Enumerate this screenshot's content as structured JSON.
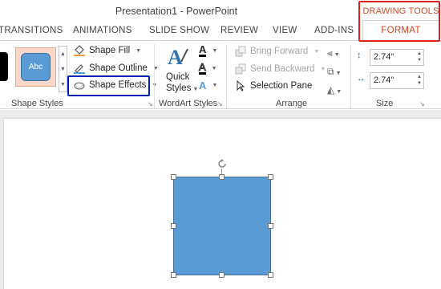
{
  "window": {
    "title": "Presentation1 - PowerPoint"
  },
  "context_tab": {
    "group": "DRAWING TOOLS",
    "tab": "FORMAT"
  },
  "tabs": [
    "TRANSITIONS",
    "ANIMATIONS",
    "SLIDE SHOW",
    "REVIEW",
    "VIEW",
    "ADD-INS"
  ],
  "shape_styles": {
    "label": "Shape Styles",
    "swatch_text": "Abc",
    "fill": "Shape Fill",
    "outline": "Shape Outline",
    "effects": "Shape Effects"
  },
  "wordart": {
    "label": "WordArt Styles",
    "quick_styles_1": "Quick",
    "quick_styles_2": "Styles"
  },
  "arrange": {
    "label": "Arrange",
    "bring_forward": "Bring Forward",
    "send_backward": "Send Backward",
    "selection_pane": "Selection Pane"
  },
  "size": {
    "label": "Size",
    "height": "2.74\"",
    "width": "2.74\""
  },
  "colors": {
    "accent": "#d24726",
    "shape_fill": "#5b9bd5",
    "highlight_red": "#e0201b",
    "highlight_blue": "#0021b5"
  }
}
